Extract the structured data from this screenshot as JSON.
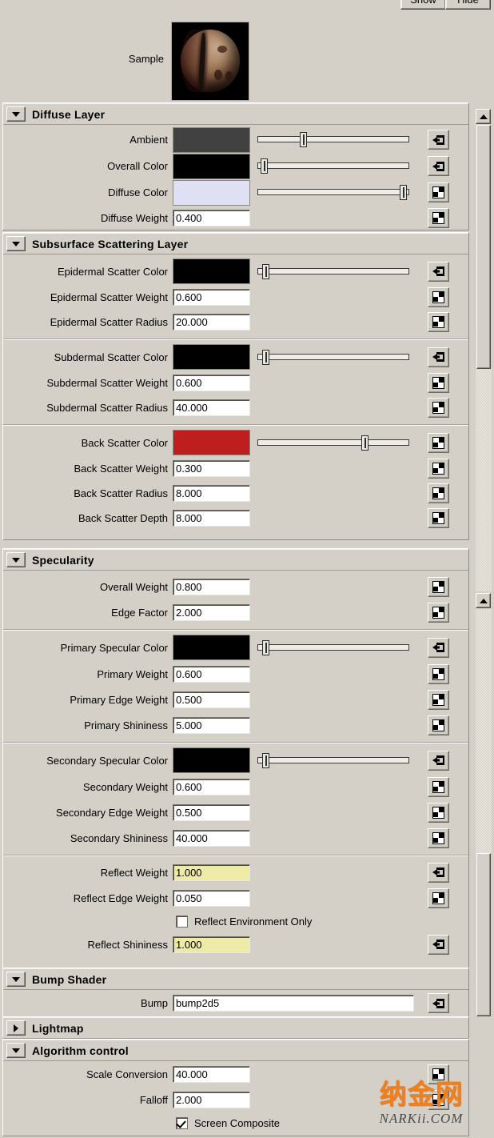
{
  "window": {
    "show_label": "Show",
    "hide_label": "Hide",
    "sample_label": "Sample"
  },
  "colors": {
    "ambient": "#414141",
    "overall": "#000000",
    "diffuse": "#e0e0f5",
    "epidermal": "#000000",
    "subdermal": "#000000",
    "back_scatter": "#be1e1e",
    "primary_specular": "#000000",
    "secondary_specular": "#000000",
    "panel_bg": "#d4d0c8",
    "highlight_field": "#eeeba6",
    "watermark": "#ef8020"
  },
  "sections": {
    "diffuse": {
      "title": "Diffuse Layer",
      "rows": [
        {
          "label": "Ambient",
          "type": "color-slider",
          "color": "#414141",
          "slider": 28,
          "icon": "connect-input-icon"
        },
        {
          "label": "Overall Color",
          "type": "color-slider",
          "color": "#000000",
          "slider": 2,
          "icon": "connect-input-icon"
        },
        {
          "label": "Diffuse Color",
          "type": "color-slider",
          "color": "#e0e0f5",
          "slider": 96,
          "icon": "texture-map-icon"
        },
        {
          "label": "Diffuse Weight",
          "type": "field",
          "value": "0.400",
          "icon": "texture-map-icon"
        }
      ]
    },
    "sss": {
      "title": "Subsurface Scattering Layer",
      "groups": [
        {
          "rows": [
            {
              "label": "Epidermal Scatter Color",
              "type": "color-slider",
              "color": "#000000",
              "slider": 3,
              "icon": "connect-input-icon"
            },
            {
              "label": "Epidermal Scatter Weight",
              "type": "field",
              "value": "0.600",
              "icon": "texture-map-icon"
            },
            {
              "label": "Epidermal Scatter Radius",
              "type": "field",
              "value": "20.000",
              "icon": "texture-map-icon"
            }
          ]
        },
        {
          "rows": [
            {
              "label": "Subdermal Scatter Color",
              "type": "color-slider",
              "color": "#000000",
              "slider": 3,
              "icon": "connect-input-icon"
            },
            {
              "label": "Subdermal Scatter Weight",
              "type": "field",
              "value": "0.600",
              "icon": "texture-map-icon"
            },
            {
              "label": "Subdermal Scatter Radius",
              "type": "field",
              "value": "40.000",
              "icon": "texture-map-icon"
            }
          ]
        },
        {
          "rows": [
            {
              "label": "Back Scatter Color",
              "type": "color-slider",
              "color": "#be1e1e",
              "slider": 70,
              "icon": "texture-map-icon"
            },
            {
              "label": "Back Scatter Weight",
              "type": "field",
              "value": "0.300",
              "icon": "texture-map-icon"
            },
            {
              "label": "Back Scatter Radius",
              "type": "field",
              "value": "8.000",
              "icon": "texture-map-icon"
            },
            {
              "label": "Back Scatter Depth",
              "type": "field",
              "value": "8.000",
              "icon": "texture-map-icon"
            }
          ]
        }
      ]
    },
    "specularity": {
      "title": "Specularity",
      "groups": [
        {
          "rows": [
            {
              "label": "Overall Weight",
              "type": "field",
              "value": "0.800",
              "icon": "texture-map-icon"
            },
            {
              "label": "Edge Factor",
              "type": "field",
              "value": "2.000",
              "icon": "texture-map-icon"
            }
          ]
        },
        {
          "rows": [
            {
              "label": "Primary Specular Color",
              "type": "color-slider",
              "color": "#000000",
              "slider": 3,
              "icon": "connect-input-icon"
            },
            {
              "label": "Primary Weight",
              "type": "field",
              "value": "0.600",
              "icon": "texture-map-icon"
            },
            {
              "label": "Primary Edge Weight",
              "type": "field",
              "value": "0.500",
              "icon": "texture-map-icon"
            },
            {
              "label": "Primary Shininess",
              "type": "field",
              "value": "5.000",
              "icon": "texture-map-icon"
            }
          ]
        },
        {
          "rows": [
            {
              "label": "Secondary Specular Color",
              "type": "color-slider",
              "color": "#000000",
              "slider": 3,
              "icon": "connect-input-icon"
            },
            {
              "label": "Secondary Weight",
              "type": "field",
              "value": "0.600",
              "icon": "texture-map-icon"
            },
            {
              "label": "Secondary Edge Weight",
              "type": "field",
              "value": "0.500",
              "icon": "texture-map-icon"
            },
            {
              "label": "Secondary Shininess",
              "type": "field",
              "value": "40.000",
              "icon": "texture-map-icon"
            }
          ]
        },
        {
          "rows": [
            {
              "label": "Reflect Weight",
              "type": "field",
              "value": "1.000",
              "highlight": true,
              "icon": "connect-input-icon"
            },
            {
              "label": "Reflect Edge Weight",
              "type": "field",
              "value": "0.050",
              "highlight": false,
              "icon": "texture-map-icon"
            },
            {
              "label": "Reflect Environment Only",
              "type": "checkbox",
              "checked": false
            },
            {
              "label": "Reflect Shininess",
              "type": "field",
              "value": "1.000",
              "highlight": true,
              "icon": "connect-input-icon"
            }
          ]
        }
      ]
    },
    "bump": {
      "title": "Bump Shader",
      "rows": [
        {
          "label": "Bump",
          "type": "text",
          "value": "bump2d5",
          "icon": "connect-input-icon"
        }
      ]
    },
    "lightmap": {
      "title": "Lightmap",
      "collapsed": true
    },
    "algorithm": {
      "title": "Algorithm control",
      "rows": [
        {
          "label": "Scale Conversion",
          "type": "field",
          "value": "40.000",
          "icon": "texture-map-icon"
        },
        {
          "label": "Falloff",
          "type": "field",
          "value": "2.000",
          "icon": "texture-map-icon"
        },
        {
          "label": "Screen Composite",
          "type": "checkbox",
          "checked": true
        }
      ]
    }
  },
  "watermark": {
    "cn": "纳金网",
    "en": "NARKii.COM"
  }
}
